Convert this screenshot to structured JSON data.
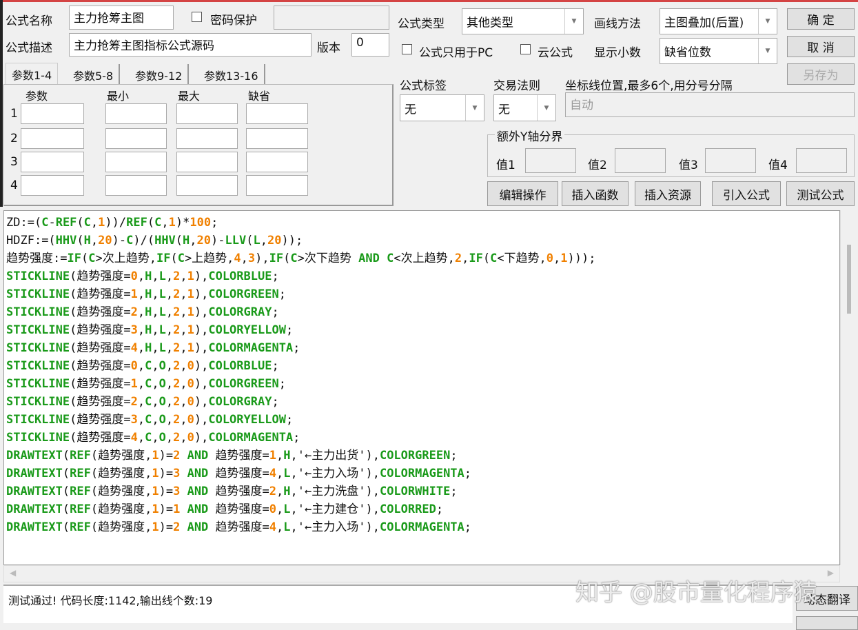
{
  "form": {
    "name_label": "公式名称",
    "name_value": "主力抢筹主图",
    "password_label": "密码保护",
    "desc_label": "公式描述",
    "desc_value": "主力抢筹主图指标公式源码",
    "version_label": "版本",
    "version_value": "0"
  },
  "tabs": [
    "参数1-4",
    "参数5-8",
    "参数9-12",
    "参数13-16"
  ],
  "params": {
    "headers": [
      "参数",
      "最小",
      "最大",
      "缺省"
    ],
    "rows": [
      "1",
      "2",
      "3",
      "4"
    ]
  },
  "right": {
    "type_label": "公式类型",
    "type_value": "其他类型",
    "draw_label": "画线方法",
    "draw_value": "主图叠加(后置)",
    "pc_only_label": "公式只用于PC",
    "cloud_label": "云公式",
    "decimal_label": "显示小数",
    "decimal_value": "缺省位数",
    "tag_label": "公式标签",
    "tag_value": "无",
    "rule_label": "交易法则",
    "rule_value": "无",
    "axis_label": "坐标线位置,最多6个,用分号分隔",
    "axis_placeholder": "自动",
    "yaxis_legend": "额外Y轴分界",
    "values": [
      "值1",
      "值2",
      "值3",
      "值4"
    ]
  },
  "buttons": {
    "ok": "确 定",
    "cancel": "取 消",
    "save_as": "另存为",
    "edit": "编辑操作",
    "insert_func": "插入函数",
    "insert_res": "插入资源",
    "import": "引入公式",
    "test": "测试公式",
    "translate": "动态翻译"
  },
  "code": [
    "ZD:=(C-REF(C,1))/REF(C,1)*100;",
    "HDZF:=(HHV(H,20)-C)/(HHV(H,20)-LLV(L,20));",
    "趋势强度:=IF(C>次上趋势,IF(C>上趋势,4,3),IF(C>次下趋势 AND C<次上趋势,2,IF(C<下趋势,0,1)));",
    "STICKLINE(趋势强度=0,H,L,2,1),COLORBLUE;",
    "STICKLINE(趋势强度=1,H,L,2,1),COLORGREEN;",
    "STICKLINE(趋势强度=2,H,L,2,1),COLORGRAY;",
    "STICKLINE(趋势强度=3,H,L,2,1),COLORYELLOW;",
    "STICKLINE(趋势强度=4,H,L,2,1),COLORMAGENTA;",
    "STICKLINE(趋势强度=0,C,O,2,0),COLORBLUE;",
    "STICKLINE(趋势强度=1,C,O,2,0),COLORGREEN;",
    "STICKLINE(趋势强度=2,C,O,2,0),COLORGRAY;",
    "STICKLINE(趋势强度=3,C,O,2,0),COLORYELLOW;",
    "STICKLINE(趋势强度=4,C,O,2,0),COLORMAGENTA;",
    "DRAWTEXT(REF(趋势强度,1)=2 AND 趋势强度=1,H,'←主力出货'),COLORGREEN;",
    "DRAWTEXT(REF(趋势强度,1)=3 AND 趋势强度=4,L,'←主力入场'),COLORMAGENTA;",
    "DRAWTEXT(REF(趋势强度,1)=3 AND 趋势强度=2,H,'←主力洗盘'),COLORWHITE;",
    "DRAWTEXT(REF(趋势强度,1)=1 AND 趋势强度=0,L,'←主力建仓'),COLORRED;",
    "DRAWTEXT(REF(趋势强度,1)=2 AND 趋势强度=4,L,'←主力入场'),COLORMAGENTA;"
  ],
  "status": "测试通过! 代码长度:1142,输出线个数:19",
  "watermark": "知乎 @股市量化程序猿",
  "colors": {
    "keyword": "#1a9a1a",
    "number": "#f08000",
    "accent": "#d44444"
  }
}
